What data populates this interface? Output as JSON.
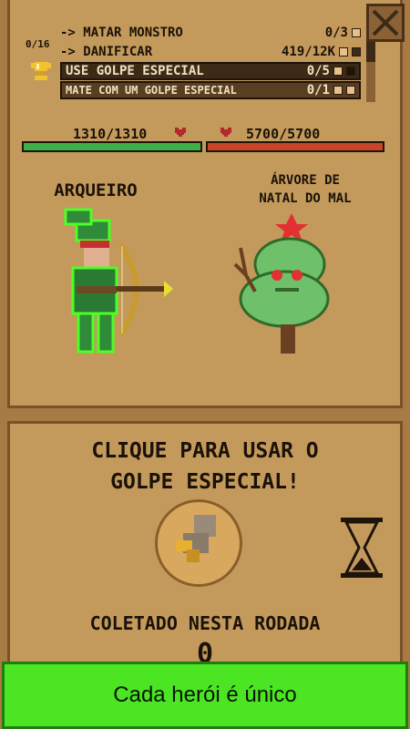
{
  "quests": {
    "count": "0/16",
    "rows": [
      {
        "label": "-> MATAR MONSTRO",
        "value": "0/3"
      },
      {
        "label": "-> DANIFICAR",
        "value": "419/12K"
      },
      {
        "label": "USE GOLPE ESPECIAL",
        "value": "0/5"
      },
      {
        "label": "MATE COM UM GOLPE ESPECIAL",
        "value": "0/1"
      }
    ]
  },
  "hero": {
    "hp": "1310/1310",
    "hp_fraction": 1.0,
    "name": "ARQUEIRO"
  },
  "enemy": {
    "hp": "5700/5700",
    "hp_fraction": 1.0,
    "name_line1": "ÁRVORE DE",
    "name_line2": "NATAL DO MAL"
  },
  "special": {
    "prompt_line1": "CLIQUE PARA USAR O",
    "prompt_line2": "GOLPE ESPECIAL!"
  },
  "collected": {
    "label": "COLETADO NESTA RODADA",
    "value": "0"
  },
  "banner": {
    "text": "Cada herói é único"
  },
  "colors": {
    "hero_hp": "#3db04a",
    "enemy_hp": "#c8452a",
    "banner": "#4ce524"
  },
  "icons": [
    "trophy-icon",
    "close-icon",
    "heart-icon",
    "hourglass-icon",
    "special-attack-icon"
  ]
}
